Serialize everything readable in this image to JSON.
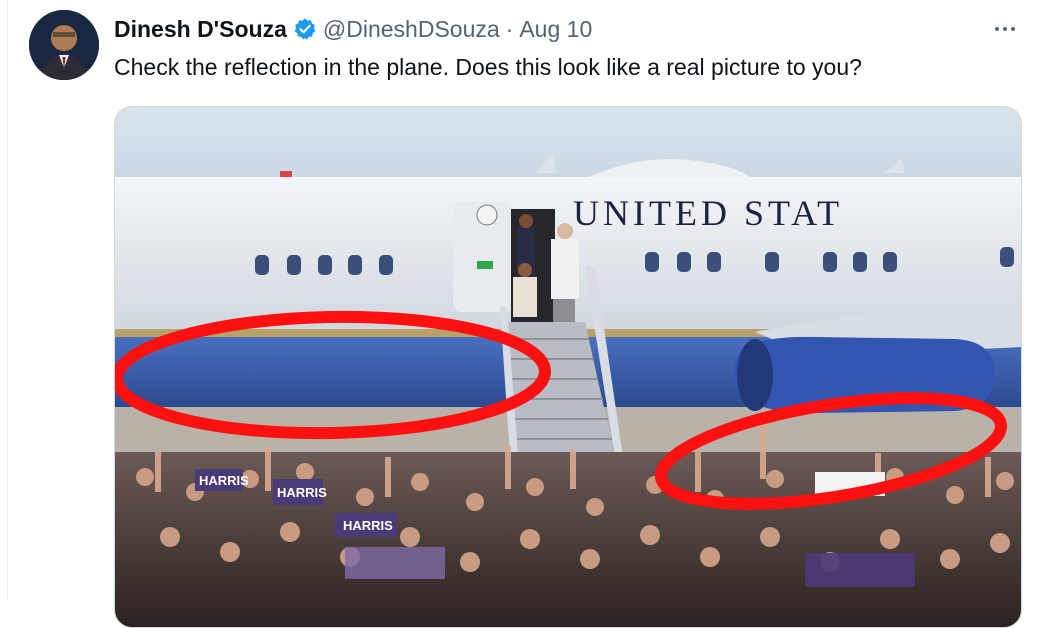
{
  "tweet": {
    "author": {
      "display_name": "Dinesh D'Souza",
      "handle": "@DineshDSouza",
      "verified": true
    },
    "separator": "·",
    "date": "Aug 10",
    "text": "Check the reflection in the plane. Does this look like a real picture to you?",
    "more_icon": "more-horizontal-icon",
    "media": {
      "plane_lettering": "UNITED STAT",
      "sign_text_1": "HARRIS",
      "sign_text_2": "HARRIS",
      "sign_text_3": "HARRIS"
    }
  },
  "colors": {
    "verified_blue": "#1d9bf0",
    "annotation_red": "#ff1010",
    "plane_blue": "#3a5aa8"
  }
}
